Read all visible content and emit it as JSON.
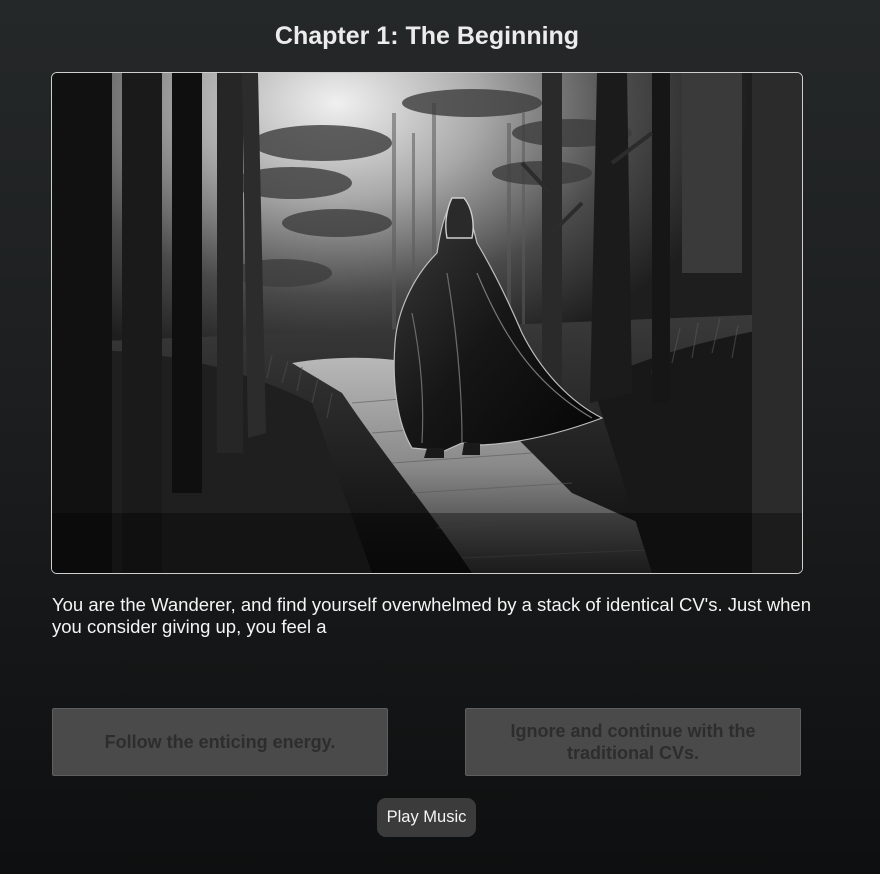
{
  "chapter": {
    "title": "Chapter 1: The Beginning"
  },
  "scene": {
    "image_icon": "hooded-wanderer-forest-illustration"
  },
  "story": {
    "text": "You are the Wanderer, and find yourself overwhelmed by a stack of identical CV's. Just when you consider giving up, you feel a"
  },
  "choices": [
    {
      "label": "Follow the enticing energy.",
      "enabled": false
    },
    {
      "label": "Ignore and continue with the traditional CVs.",
      "enabled": false
    }
  ],
  "controls": {
    "music_label": "Play Music"
  },
  "colors": {
    "background": "#1c1e1f",
    "choice_disabled_bg": "#4a4a4a",
    "choice_disabled_text": "#2d2d2d",
    "music_button_bg": "#3b3b3b"
  }
}
